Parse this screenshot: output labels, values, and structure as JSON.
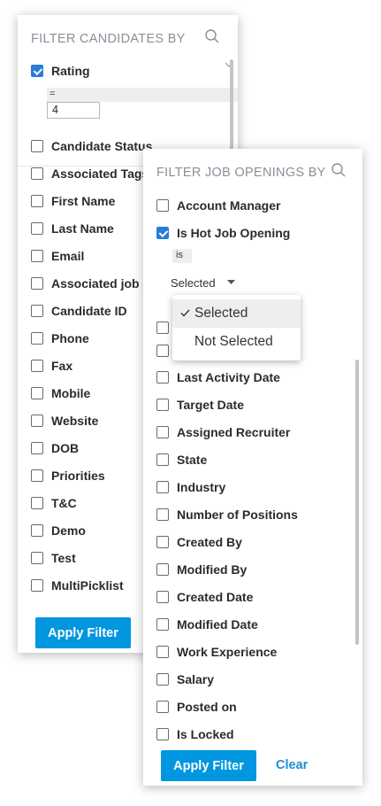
{
  "candidates_panel": {
    "title": "FILTER CANDIDATES BY",
    "rating": {
      "label": "Rating",
      "checked": true,
      "operator": "=",
      "value": "4"
    },
    "items": [
      {
        "label": "Candidate Status",
        "checked": false
      },
      {
        "label": "Associated Tags",
        "checked": false
      },
      {
        "label": "First Name",
        "checked": false
      },
      {
        "label": "Last Name",
        "checked": false
      },
      {
        "label": "Email",
        "checked": false
      },
      {
        "label": "Associated job o",
        "checked": false
      },
      {
        "label": "Candidate ID",
        "checked": false
      },
      {
        "label": "Phone",
        "checked": false
      },
      {
        "label": "Fax",
        "checked": false
      },
      {
        "label": "Mobile",
        "checked": false
      },
      {
        "label": "Website",
        "checked": false
      },
      {
        "label": "DOB",
        "checked": false
      },
      {
        "label": "Priorities",
        "checked": false
      },
      {
        "label": "T&C",
        "checked": false
      },
      {
        "label": "Demo",
        "checked": false
      },
      {
        "label": "Test",
        "checked": false
      },
      {
        "label": "MultiPicklist",
        "checked": false
      }
    ],
    "apply_label": "Apply Filter"
  },
  "job_openings_panel": {
    "title": "FILTER JOB OPENINGS BY",
    "items_top": [
      {
        "label": "Account Manager",
        "checked": false
      },
      {
        "label": "Is Hot Job Opening",
        "checked": true
      }
    ],
    "hot_job": {
      "operator": "is",
      "selected_value": "Selected"
    },
    "items_bottom": [
      {
        "label": "Last Activity Date",
        "checked": false
      },
      {
        "label": "Target Date",
        "checked": false
      },
      {
        "label": "Assigned Recruiter",
        "checked": false
      },
      {
        "label": "State",
        "checked": false
      },
      {
        "label": "Industry",
        "checked": false
      },
      {
        "label": "Number of Positions",
        "checked": false
      },
      {
        "label": "Created By",
        "checked": false
      },
      {
        "label": "Modified By",
        "checked": false
      },
      {
        "label": "Created Date",
        "checked": false
      },
      {
        "label": "Modified Date",
        "checked": false
      },
      {
        "label": "Work Experience",
        "checked": false
      },
      {
        "label": "Salary",
        "checked": false
      },
      {
        "label": "Posted on",
        "checked": false
      },
      {
        "label": "Is Locked",
        "checked": false
      }
    ],
    "apply_label": "Apply Filter",
    "clear_label": "Clear"
  },
  "dropdown": {
    "options": [
      {
        "label": "Selected",
        "selected": true
      },
      {
        "label": "Not Selected",
        "selected": false
      }
    ]
  },
  "icons": {
    "search": "search-icon",
    "check": "check-icon",
    "caret": "caret-down-icon"
  },
  "colors": {
    "accent": "#0096e0",
    "checkbox_checked": "#2a7bd5",
    "link": "#1a8fd8",
    "title_gray": "#8a8f99"
  }
}
